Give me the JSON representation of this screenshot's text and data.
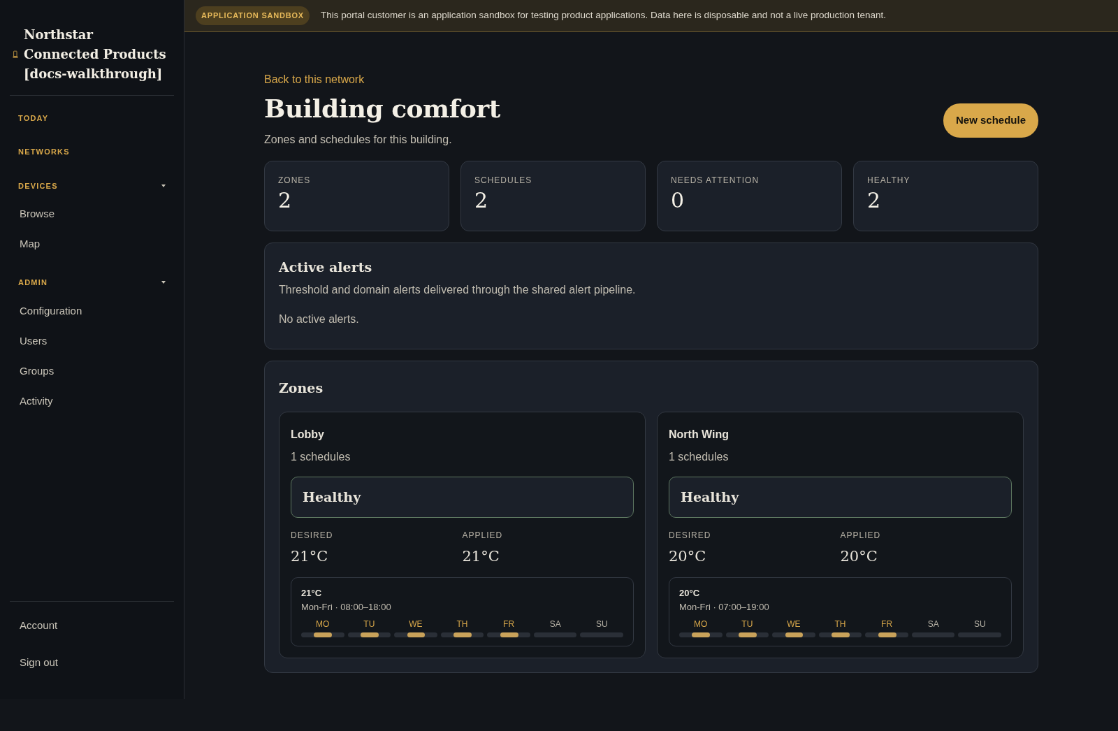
{
  "sidebar": {
    "brand": "Northstar Connected Products [docs-walkthrough]",
    "nav": [
      {
        "label": "TODAY",
        "kind": "link"
      },
      {
        "label": "NETWORKS",
        "kind": "link"
      },
      {
        "label": "DEVICES",
        "kind": "group",
        "expanded": true,
        "children": [
          {
            "label": "Browse"
          },
          {
            "label": "Map"
          }
        ]
      },
      {
        "label": "ADMIN",
        "kind": "group",
        "expanded": true,
        "children": [
          {
            "label": "Configuration"
          },
          {
            "label": "Users"
          },
          {
            "label": "Groups"
          },
          {
            "label": "Activity"
          }
        ]
      }
    ],
    "footer": [
      {
        "label": "Account"
      },
      {
        "label": "Sign out"
      }
    ]
  },
  "banner": {
    "badge": "APPLICATION SANDBOX",
    "text": "This portal customer is an application sandbox for testing product applications. Data here is disposable and not a live production tenant."
  },
  "header": {
    "back_link": "Back to this network",
    "title": "Building comfort",
    "subtitle": "Zones and schedules for this building.",
    "button": "New schedule"
  },
  "stats": [
    {
      "label": "ZONES",
      "value": "2"
    },
    {
      "label": "SCHEDULES",
      "value": "2"
    },
    {
      "label": "NEEDS ATTENTION",
      "value": "0"
    },
    {
      "label": "HEALTHY",
      "value": "2"
    }
  ],
  "alerts": {
    "title": "Active alerts",
    "description": "Threshold and domain alerts delivered through the shared alert pipeline.",
    "empty": "No active alerts."
  },
  "zones": {
    "title": "Zones",
    "items": [
      {
        "name": "Lobby",
        "count": "1 schedules",
        "status": "Healthy",
        "desired_label": "DESIRED",
        "desired": "21°C",
        "applied_label": "APPLIED",
        "applied": "21°C",
        "schedule": {
          "temp": "21°C",
          "when": "Mon-Fri · 08:00–18:00",
          "days": [
            {
              "label": "MO",
              "active": true
            },
            {
              "label": "TU",
              "active": true
            },
            {
              "label": "WE",
              "active": true
            },
            {
              "label": "TH",
              "active": true
            },
            {
              "label": "FR",
              "active": true
            },
            {
              "label": "SA",
              "active": false
            },
            {
              "label": "SU",
              "active": false
            }
          ]
        }
      },
      {
        "name": "North Wing",
        "count": "1 schedules",
        "status": "Healthy",
        "desired_label": "DESIRED",
        "desired": "20°C",
        "applied_label": "APPLIED",
        "applied": "20°C",
        "schedule": {
          "temp": "20°C",
          "when": "Mon-Fri · 07:00–19:00",
          "days": [
            {
              "label": "MO",
              "active": true
            },
            {
              "label": "TU",
              "active": true
            },
            {
              "label": "WE",
              "active": true
            },
            {
              "label": "TH",
              "active": true
            },
            {
              "label": "FR",
              "active": true
            },
            {
              "label": "SA",
              "active": false
            },
            {
              "label": "SU",
              "active": false
            }
          ]
        }
      }
    ]
  }
}
